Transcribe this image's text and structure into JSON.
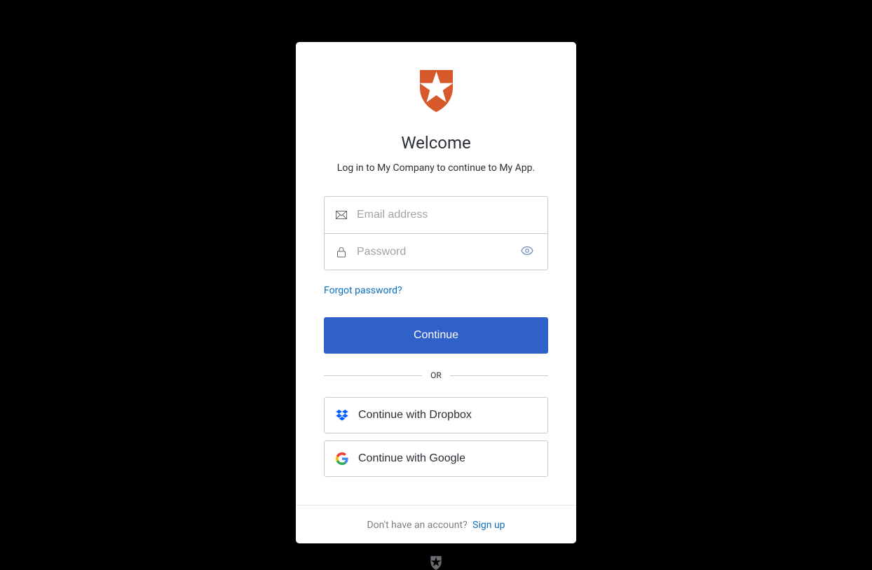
{
  "header": {
    "title": "Welcome",
    "subtitle": "Log in to My Company to continue to My App."
  },
  "form": {
    "email_placeholder": "Email address",
    "password_placeholder": "Password",
    "forgot_label": "Forgot password?",
    "continue_label": "Continue"
  },
  "divider": {
    "label": "OR"
  },
  "social": {
    "dropbox_label": "Continue with Dropbox",
    "google_label": "Continue with Google"
  },
  "footer": {
    "prompt": "Don't have an account?",
    "signup_label": "Sign up"
  },
  "colors": {
    "brand_shield": "#D7582A",
    "primary_button": "#3061c9",
    "link": "#0a6ebd",
    "dropbox": "#0061FE"
  }
}
